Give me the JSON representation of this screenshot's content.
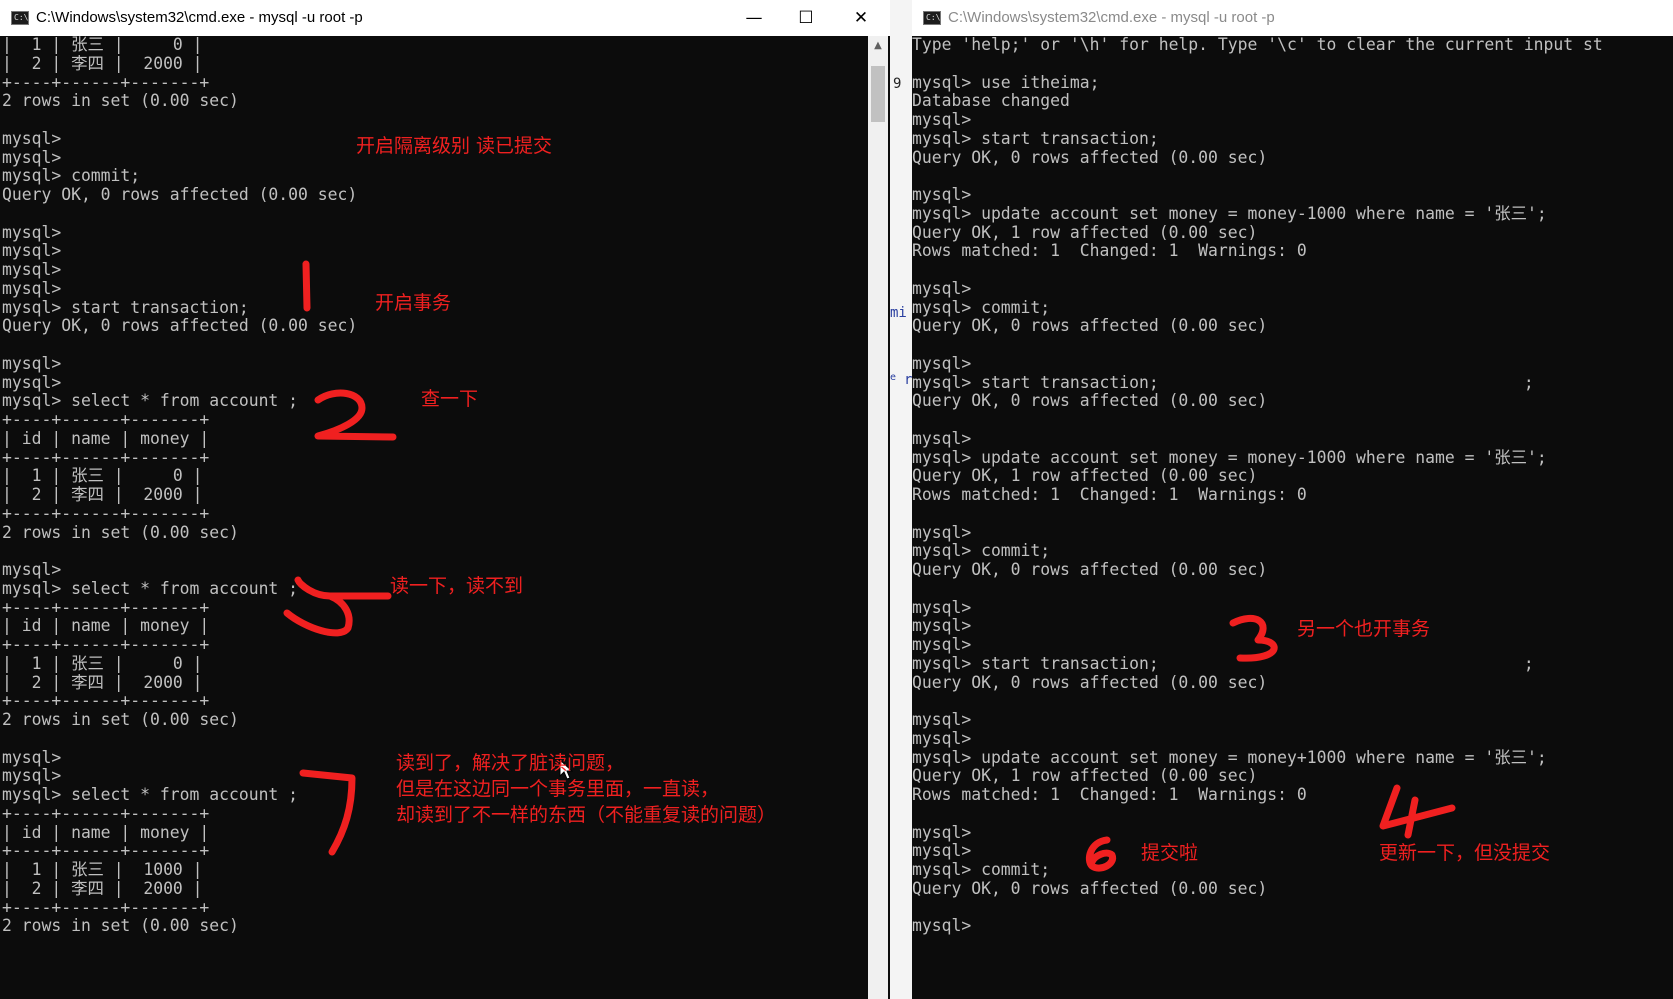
{
  "left_window": {
    "title": "C:\\Windows\\system32\\cmd.exe - mysql  -u root -p",
    "buttons": {
      "minimize": "—",
      "maximize": "☐",
      "close": "✕"
    },
    "lines": [
      "|  1 | 张三 |     0 |",
      "|  2 | 李四 |  2000 |",
      "+----+------+-------+",
      "2 rows in set (0.00 sec)",
      "",
      "mysql>",
      "mysql>",
      "mysql> commit;",
      "Query OK, 0 rows affected (0.00 sec)",
      "",
      "mysql>",
      "mysql>",
      "mysql>",
      "mysql>",
      "mysql> start transaction;",
      "Query OK, 0 rows affected (0.00 sec)",
      "",
      "mysql>",
      "mysql>",
      "mysql> select * from account ;",
      "+----+------+-------+",
      "| id | name | money |",
      "+----+------+-------+",
      "|  1 | 张三 |     0 |",
      "|  2 | 李四 |  2000 |",
      "+----+------+-------+",
      "2 rows in set (0.00 sec)",
      "",
      "mysql>",
      "mysql> select * from account ;",
      "+----+------+-------+",
      "| id | name | money |",
      "+----+------+-------+",
      "|  1 | 张三 |     0 |",
      "|  2 | 李四 |  2000 |",
      "+----+------+-------+",
      "2 rows in set (0.00 sec)",
      "",
      "mysql>",
      "mysql>",
      "mysql> select * from account ;",
      "+----+------+-------+",
      "| id | name | money |",
      "+----+------+-------+",
      "|  1 | 张三 |  1000 |",
      "|  2 | 李四 |  2000 |",
      "+----+------+-------+",
      "2 rows in set (0.00 sec)"
    ]
  },
  "right_window": {
    "title": "C:\\Windows\\system32\\cmd.exe - mysql  -u root -p",
    "lines": [
      "Type 'help;' or '\\h' for help. Type '\\c' to clear the current input st",
      "",
      "mysql> use itheima;",
      "Database changed",
      "mysql>",
      "mysql> start transaction;",
      "Query OK, 0 rows affected (0.00 sec)",
      "",
      "mysql>",
      "mysql> update account set money = money-1000 where name = '张三';",
      "Query OK, 1 row affected (0.00 sec)",
      "Rows matched: 1  Changed: 1  Warnings: 0",
      "",
      "mysql>",
      "mysql> commit;",
      "Query OK, 0 rows affected (0.00 sec)",
      "",
      "mysql>",
      "mysql> start transaction;                                     ;",
      "Query OK, 0 rows affected (0.00 sec)",
      "",
      "mysql>",
      "mysql> update account set money = money-1000 where name = '张三';",
      "Query OK, 1 row affected (0.00 sec)",
      "Rows matched: 1  Changed: 1  Warnings: 0",
      "",
      "mysql>",
      "mysql> commit;",
      "Query OK, 0 rows affected (0.00 sec)",
      "",
      "mysql>",
      "mysql>",
      "mysql>",
      "mysql> start transaction;                                     ;",
      "Query OK, 0 rows affected (0.00 sec)",
      "",
      "mysql>",
      "mysql>",
      "mysql> update account set money = money+1000 where name = '张三';",
      "Query OK, 1 row affected (0.00 sec)",
      "Rows matched: 1  Changed: 1  Warnings: 0",
      "",
      "mysql>",
      "mysql>",
      "mysql> commit;",
      "Query OK, 0 rows affected (0.00 sec)",
      "",
      "mysql>"
    ]
  },
  "background_fragments": [
    "9",
    "mi",
    "r",
    "e"
  ],
  "annotations": {
    "isolation": "开启隔离级别 读已提交",
    "step1": "开启事务",
    "step2": "查一下",
    "step5": "读一下，读不到",
    "step7_line1": "读到了，解决了脏读问题，",
    "step7_line2": "但是在这边同一个事务里面，一直读，",
    "step7_line3": "却读到了不一样的东西（不能重复读的问题）",
    "step3": "另一个也开事务",
    "step6": "提交啦",
    "step4": "更新一下，但没提交"
  },
  "colors": {
    "console_bg": "#0c0c0c",
    "console_text": "#c0c0c0",
    "annotation_red": "#f02020"
  }
}
